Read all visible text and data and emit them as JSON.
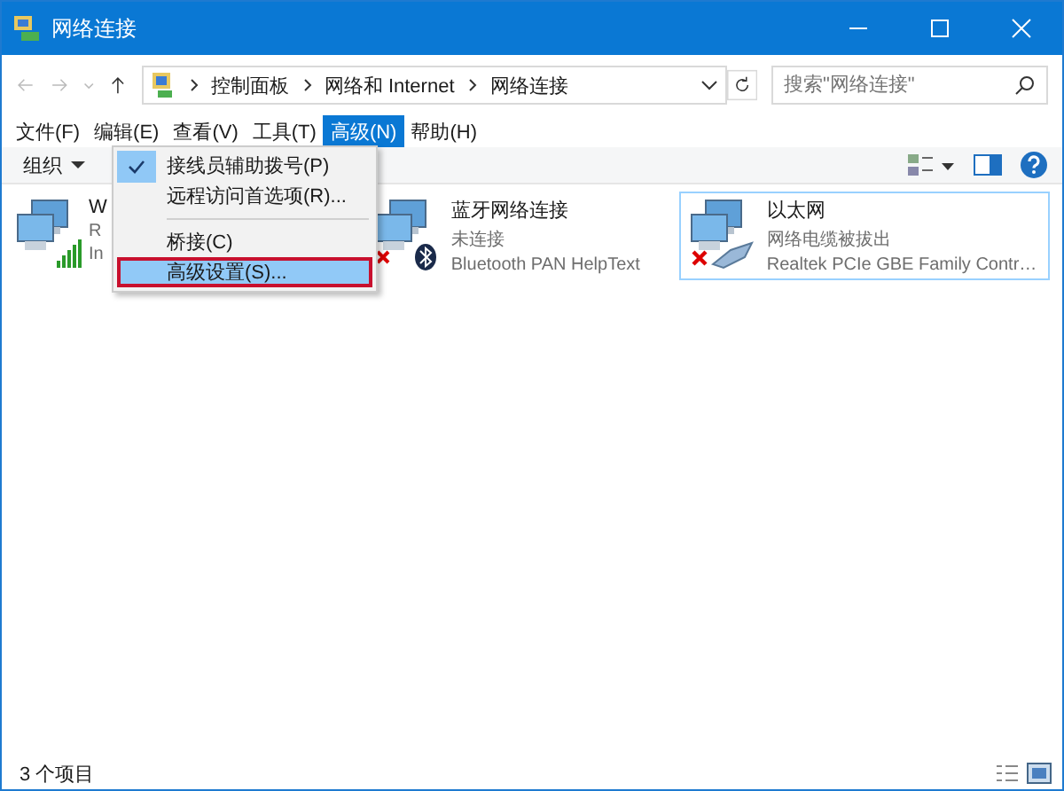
{
  "window": {
    "title": "网络连接"
  },
  "address": {
    "path": [
      "控制面板",
      "网络和 Internet",
      "网络连接"
    ]
  },
  "search": {
    "placeholder": "搜索\"网络连接\""
  },
  "menu_bar": [
    {
      "label": "文件(F)",
      "selected": false
    },
    {
      "label": "编辑(E)",
      "selected": false
    },
    {
      "label": "查看(V)",
      "selected": false
    },
    {
      "label": "工具(T)",
      "selected": false
    },
    {
      "label": "高级(N)",
      "selected": true
    },
    {
      "label": "帮助(H)",
      "selected": false
    }
  ],
  "toolbar": {
    "organize": "组织"
  },
  "dropdown": [
    {
      "kind": "item",
      "label": "接线员辅助拨号(P)",
      "checked": true,
      "selected": false
    },
    {
      "kind": "item",
      "label": "远程访问首选项(R)...",
      "checked": false,
      "selected": false
    },
    {
      "kind": "separator"
    },
    {
      "kind": "item",
      "label": "桥接(C)",
      "checked": false,
      "selected": false
    },
    {
      "kind": "item",
      "label": "高级设置(S)...",
      "checked": false,
      "selected": true
    }
  ],
  "connections": [
    {
      "name": "W",
      "status": "R",
      "device": "In",
      "kind": "signal",
      "selected": false
    },
    {
      "name": "蓝牙网络连接",
      "status": "未连接",
      "device": "Bluetooth PAN HelpText",
      "kind": "bluetooth",
      "selected": false
    },
    {
      "name": "以太网",
      "status": "网络电缆被拔出",
      "device": "Realtek PCIe GBE Family Contr…",
      "kind": "unplugged",
      "selected": true
    }
  ],
  "status_bar": {
    "count": "3 个项目"
  }
}
